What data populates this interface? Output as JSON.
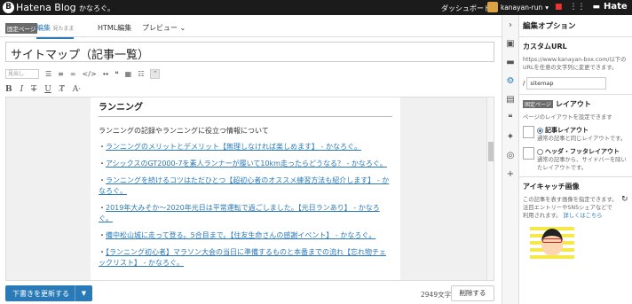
{
  "topbar": {
    "logo_text": "Hatena Blog",
    "blog_name": "かなろぐ。",
    "dashboard": "ダッシュボード",
    "username": "kanayan-run",
    "hatena": "Hate"
  },
  "tabs": {
    "fixed_page": "固定ページ",
    "edit": "編集",
    "edit_sub": "見たまま",
    "html": "HTML編集",
    "preview": "プレビュー"
  },
  "title": "サイトマップ（記事一覧）",
  "toolbar": {
    "heading_select": "見出し"
  },
  "content": {
    "heading": "ランニング",
    "intro": "ランニングの記録やランニングに役立つ情報について",
    "items": [
      "ランニングのメリットとデメリット【無理しなければ楽しめます】 - かなろぐ。",
      "アシックスのGT2000-7を素人ランナーが履いて10km走ったらどうなる？ - かなろぐ。",
      "ランニングを続けるコツはただひとつ【超初心者のオススメ練習方法も紹介します】 - かなろぐ。",
      "2019年大みそか～2020年元日は平常運転で過ごしました。【元日ランあり】 - かなろぐ。",
      "備中松山城に走って登る。5合目まで。【住友生命さんの感謝イベント】 - かなろぐ。",
      "【ランニング初心者】マラソン大会の当日に準備するものと本番までの流れ【忘れ物チェックリスト】 - かなろぐ。"
    ]
  },
  "footer": {
    "save_label": "下書きを更新する",
    "char_count": "2949文字",
    "delete_label": "削除する"
  },
  "sidepanel": {
    "title": "編集オプション",
    "custom_url_title": "カスタムURL",
    "custom_url_desc": "https://www.kanayan-box.com/以下のURLを任意の文字列に変更できます。",
    "url_prefix": "/",
    "url_value": "sitemap",
    "layout_tag": "固定ページ",
    "layout_title": "レイアウト",
    "layout_desc": "ページのレイアウトを設定できます",
    "layout_opt1_title": "記事レイアウト",
    "layout_opt1_desc": "通常の記事と同じレイアウトです。",
    "layout_opt2_title": "ヘッダ・フッタレイアウト",
    "layout_opt2_desc": "通常の記事から、サイドバーを除いたレイアウトです。",
    "eyecatch_title": "アイキャッチ画像",
    "eyecatch_desc": "この記事を表す画像を指定できます。注目エントリーやSNSシェアなどで利用されます。",
    "eyecatch_link": "詳しくはこちら"
  }
}
